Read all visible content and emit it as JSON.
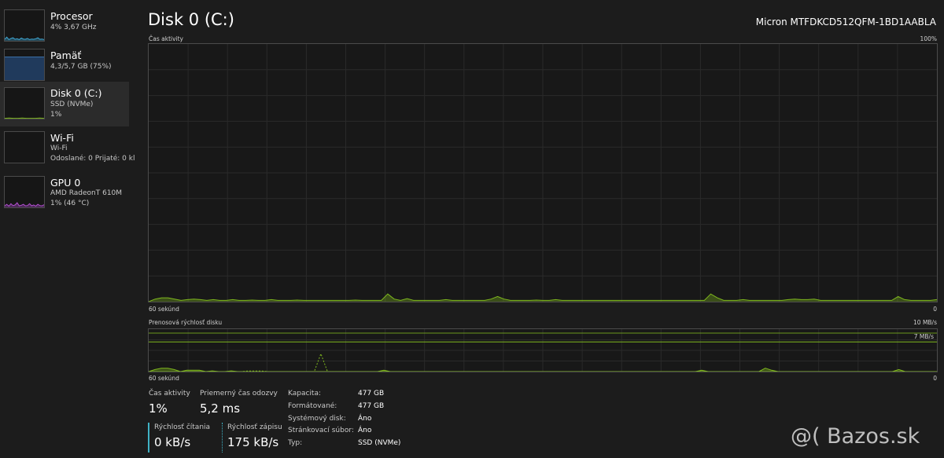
{
  "sidebar": {
    "items": [
      {
        "name": "Procesor",
        "line1": "4% 3,67 GHz",
        "line2": ""
      },
      {
        "name": "Pamäť",
        "line1": "4,3/5,7 GB (75%)",
        "line2": ""
      },
      {
        "name": "Disk 0 (C:)",
        "line1": "SSD (NVMe)",
        "line2": "1%"
      },
      {
        "name": "Wi-Fi",
        "line1": "Wi-Fi",
        "line2": "Odoslané: 0 Prijaté: 0 kl"
      },
      {
        "name": "GPU 0",
        "line1": "AMD RadeonT 610M",
        "line2": "1% (46 °C)"
      }
    ],
    "memory_used_fraction": 0.75
  },
  "header": {
    "title": "Disk 0 (C:)",
    "device": "Micron MTFDKCD512QFM-1BD1AABLA"
  },
  "activity_graph": {
    "label": "Čas aktivity",
    "max_label": "100%",
    "time_label": "60 sekúnd",
    "min_label": "0",
    "color": "#7fb81e",
    "max_value": 100,
    "values": [
      0,
      1,
      1.5,
      1.5,
      1,
      0.5,
      0.8,
      1,
      0.8,
      0.5,
      0.8,
      0.5,
      0.5,
      0.8,
      0.5,
      0.5,
      0.6,
      0.5,
      0.5,
      0.8,
      0.5,
      0.5,
      0.5,
      0.6,
      0.5,
      0.5,
      0.5,
      0.5,
      0.5,
      0.5,
      0.5,
      0.5,
      0.6,
      0.5,
      0.5,
      0.5,
      0.5,
      3,
      1,
      0.5,
      1.2,
      0.5,
      0.5,
      0.5,
      0.5,
      0.5,
      0.8,
      0.5,
      0.5,
      0.5,
      0.5,
      0.5,
      0.5,
      1,
      2,
      1,
      0.5,
      0.5,
      0.5,
      0.5,
      0.6,
      0.5,
      0.5,
      0.8,
      0.5,
      0.5,
      0.5,
      0.5,
      0.5,
      0.5,
      0.5,
      0.5,
      0.5,
      0.5,
      0.5,
      0.5,
      0.5,
      0.5,
      0.5,
      0.5,
      0.5,
      0.5,
      0.5,
      0.5,
      0.5,
      0.5,
      0.5,
      3,
      1.5,
      0.5,
      0.5,
      0.5,
      0.8,
      0.5,
      0.5,
      0.5,
      0.5,
      0.5,
      0.5,
      0.8,
      1,
      0.8,
      0.8,
      1,
      0.5,
      0.5,
      0.5,
      0.5,
      0.5,
      0.5,
      0.5,
      0.5,
      0.5,
      0.5,
      0.5,
      0.5,
      2,
      0.8,
      0.5,
      0.5,
      0.5,
      0.5,
      0.8
    ],
    "grid": true
  },
  "transfer_graph": {
    "label": "Prenosová rýchlosť disku",
    "max_label": "10 MB/s",
    "scale_line_label": "7 MB/s",
    "scale_line_value": 7,
    "max_value": 10,
    "time_label": "60 sekúnd",
    "min_label": "0",
    "read_color": "#7fb81e",
    "write_color": "#7fb81e",
    "read_values": [
      0,
      0.3,
      0.5,
      0.5,
      0.3,
      0,
      0.2,
      0.2,
      0.2,
      0,
      0.1,
      0,
      0,
      0.1,
      0,
      0,
      0,
      0,
      0,
      0,
      0,
      0,
      0,
      0,
      0,
      0,
      0,
      0,
      0,
      0,
      0,
      0,
      0,
      0,
      0,
      0,
      0,
      0.2,
      0,
      0,
      0,
      0,
      0,
      0,
      0,
      0,
      0,
      0,
      0,
      0,
      0,
      0,
      0,
      0,
      0,
      0,
      0,
      0,
      0,
      0,
      0,
      0,
      0,
      0,
      0,
      0,
      0,
      0,
      0,
      0,
      0,
      0,
      0,
      0,
      0,
      0,
      0,
      0,
      0,
      0,
      0,
      0,
      0,
      0,
      0,
      0,
      0,
      0.2,
      0,
      0,
      0,
      0,
      0,
      0,
      0,
      0,
      0,
      0.5,
      0.2,
      0,
      0,
      0,
      0,
      0,
      0,
      0,
      0,
      0,
      0,
      0,
      0,
      0,
      0,
      0,
      0,
      0,
      0,
      0,
      0.3,
      0,
      0,
      0,
      0,
      0,
      0
    ],
    "write_values": [
      0,
      0,
      0,
      0,
      0,
      0,
      0,
      0,
      0,
      0,
      0,
      0,
      0,
      0,
      0,
      0.1,
      0.1,
      0.1,
      0,
      0,
      0,
      0,
      0,
      0,
      0,
      0,
      3,
      0,
      0,
      0,
      0,
      0,
      0,
      0,
      0,
      0,
      0,
      0,
      0,
      0,
      0,
      0,
      0,
      0,
      0,
      0,
      0,
      0,
      0,
      0,
      0,
      0,
      0,
      0,
      0,
      0,
      0,
      0,
      0,
      0,
      0,
      0,
      0,
      0,
      0,
      0,
      0,
      0,
      0,
      0,
      0,
      0,
      0,
      0,
      0,
      0,
      0,
      0,
      0,
      0,
      0,
      0,
      0,
      0,
      0,
      0,
      0,
      0,
      0,
      0,
      0,
      0,
      0,
      0,
      0,
      0,
      0,
      0,
      0,
      0,
      0,
      0,
      0,
      0,
      0,
      0,
      0,
      0,
      0,
      0,
      0,
      0,
      0,
      0,
      0,
      0,
      0,
      0,
      0,
      0
    ]
  },
  "stats": {
    "activity_label": "Čas aktivity",
    "activity_value": "1%",
    "response_label": "Priemerný čas odozvy",
    "response_value": "5,2 ms",
    "read_label": "Rýchlosť čítania",
    "read_value": "0 kB/s",
    "write_label": "Rýchlosť zápisu",
    "write_value": "175 kB/s"
  },
  "properties": [
    {
      "key": "Kapacita:",
      "value": "477 GB"
    },
    {
      "key": "Formátované:",
      "value": "477 GB"
    },
    {
      "key": "Systémový disk:",
      "value": "Áno"
    },
    {
      "key": "Stránkovací súbor:",
      "value": "Áno"
    },
    {
      "key": "Typ:",
      "value": "SSD (NVMe)"
    }
  ],
  "watermark": "@( Bazos.sk",
  "colors": {
    "background": "#1c1c1c",
    "selected": "#2b2b2b",
    "disk": "#7fb81e",
    "cpu": "#3fa9d6",
    "memory": "#3a6ea5",
    "gpu": "#b24fd1",
    "accent_bar": "#3fb2c5"
  },
  "icons": {
    "watermark_logo": "bazos-logo"
  }
}
